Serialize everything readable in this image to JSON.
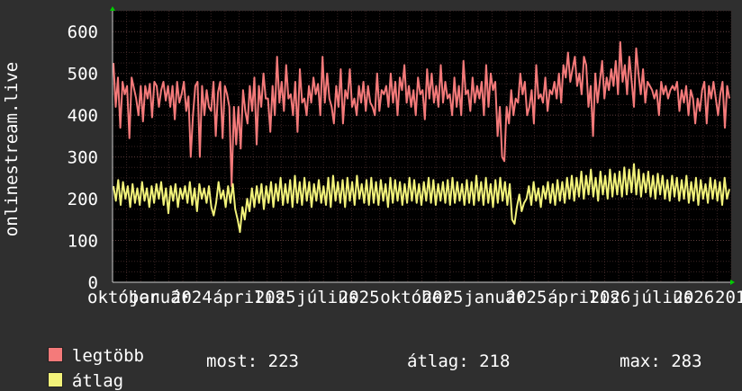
{
  "chart_data": {
    "type": "line",
    "ylabel": "onlinestream.live",
    "ylim": [
      0,
      650
    ],
    "y_ticks": [
      0,
      100,
      200,
      300,
      400,
      500,
      600
    ],
    "x_tick_labels": [
      "október",
      "január",
      "2024",
      "április",
      "2025",
      "július",
      "2025",
      "október",
      "2025",
      "január",
      "2025",
      "április",
      "2026",
      "július",
      "2026",
      "201"
    ],
    "grid": true,
    "colors": {
      "background": "#2f2f2f",
      "plot": "#000000",
      "grid_major": "#5a3a3a",
      "grid_minor": "#3a2424",
      "max": "#f47a7a",
      "avg": "#f2f27a",
      "axis_arrow": "#00cc00"
    },
    "series": [
      {
        "name": "legtöbb",
        "color": "#f47a7a",
        "values": [
          525,
          420,
          490,
          370,
          480,
          450,
          470,
          345,
          490,
          465,
          440,
          400,
          470,
          385,
          470,
          440,
          475,
          395,
          480,
          470,
          420,
          460,
          480,
          435,
          470,
          420,
          470,
          390,
          480,
          430,
          450,
          480,
          410,
          445,
          300,
          400,
          470,
          480,
          300,
          470,
          400,
          460,
          420,
          410,
          480,
          350,
          455,
          480,
          345,
          470,
          450,
          420,
          230,
          420,
          330,
          420,
          320,
          460,
          410,
          380,
          470,
          410,
          490,
          330,
          470,
          420,
          500,
          440,
          440,
          360,
          470,
          400,
          540,
          430,
          480,
          410,
          520,
          440,
          450,
          400,
          480,
          360,
          510,
          430,
          440,
          400,
          470,
          430,
          490,
          450,
          475,
          400,
          540,
          430,
          500,
          440,
          420,
          380,
          470,
          420,
          510,
          380,
          460,
          440,
          510,
          420,
          440,
          400,
          470,
          430,
          480,
          410,
          470,
          430,
          420,
          400,
          500,
          410,
          460,
          450,
          470,
          420,
          500,
          430,
          480,
          400,
          490,
          460,
          520,
          430,
          470,
          420,
          460,
          400,
          490,
          450,
          460,
          390,
          510,
          440,
          500,
          430,
          470,
          420,
          520,
          430,
          480,
          440,
          450,
          400,
          490,
          420,
          470,
          400,
          530,
          450,
          460,
          410,
          490,
          430,
          470,
          440,
          480,
          400,
          520,
          420,
          500,
          460,
          480,
          350,
          420,
          300,
          290,
          420,
          380,
          460,
          400,
          440,
          430,
          500,
          450,
          480,
          400,
          420,
          460,
          380,
          520,
          440,
          450,
          430,
          490,
          410,
          460,
          450,
          480,
          440,
          500,
          430,
          520,
          490,
          550,
          480,
          510,
          540,
          470,
          500,
          450,
          540,
          520,
          420,
          470,
          350,
          500,
          430,
          480,
          530,
          440,
          490,
          460,
          510,
          470,
          530,
          450,
          575,
          480,
          520,
          450,
          540,
          480,
          420,
          560,
          500,
          450,
          510,
          430,
          480,
          470,
          460,
          440,
          460,
          400,
          480,
          450,
          470,
          440,
          460,
          470,
          460,
          480,
          410,
          460,
          430,
          470,
          400,
          460,
          440,
          380,
          440,
          410,
          460,
          480,
          380,
          470,
          440,
          480,
          440,
          400,
          450,
          480,
          370,
          470,
          440
        ]
      },
      {
        "name": "átlag",
        "color": "#f2f27a",
        "values": [
          230,
          195,
          245,
          185,
          240,
          200,
          230,
          180,
          235,
          190,
          225,
          185,
          240,
          195,
          225,
          180,
          230,
          190,
          235,
          200,
          240,
          185,
          225,
          165,
          230,
          195,
          235,
          180,
          225,
          200,
          230,
          190,
          240,
          185,
          225,
          170,
          235,
          200,
          225,
          190,
          230,
          180,
          160,
          190,
          240,
          200,
          220,
          180,
          230,
          190,
          235,
          175,
          150,
          120,
          180,
          150,
          200,
          170,
          225,
          180,
          230,
          190,
          235,
          175,
          230,
          190,
          240,
          180,
          235,
          195,
          250,
          185,
          235,
          190,
          245,
          180,
          255,
          190,
          240,
          185,
          250,
          195,
          240,
          180,
          235,
          195,
          245,
          190,
          230,
          185,
          250,
          180,
          255,
          195,
          240,
          190,
          245,
          180,
          250,
          195,
          240,
          185,
          255,
          200,
          235,
          190,
          245,
          185,
          250,
          190,
          240,
          185,
          245,
          195,
          235,
          180,
          250,
          190,
          245,
          195,
          240,
          185,
          235,
          190,
          250,
          195,
          245,
          190,
          235,
          185,
          240,
          195,
          250,
          190,
          245,
          185,
          235,
          195,
          240,
          190,
          245,
          185,
          250,
          190,
          240,
          195,
          235,
          185,
          245,
          190,
          240,
          185,
          255,
          195,
          240,
          185,
          250,
          190,
          235,
          180,
          245,
          190,
          250,
          195,
          240,
          185,
          235,
          150,
          140,
          180,
          210,
          170,
          190,
          200,
          230,
          185,
          240,
          195,
          225,
          180,
          230,
          200,
          240,
          190,
          235,
          185,
          245,
          195,
          240,
          190,
          250,
          200,
          255,
          195,
          250,
          205,
          265,
          200,
          255,
          210,
          270,
          205,
          250,
          195,
          265,
          210,
          255,
          200,
          270,
          205,
          260,
          210,
          265,
          205,
          275,
          210,
          270,
          215,
          283,
          210,
          270,
          205,
          260,
          215,
          265,
          205,
          255,
          200,
          260,
          210,
          255,
          200,
          245,
          195,
          255,
          205,
          250,
          195,
          245,
          200,
          255,
          190,
          240,
          195,
          250,
          185,
          245,
          200,
          235,
          190,
          250,
          200,
          245,
          195,
          240,
          185,
          250,
          200,
          223
        ]
      }
    ]
  },
  "legend": {
    "max_label": "legtöbb",
    "avg_label": "átlag"
  },
  "stats": {
    "now": "most: 223",
    "avg": "átlag: 218",
    "max": "max: 283"
  }
}
